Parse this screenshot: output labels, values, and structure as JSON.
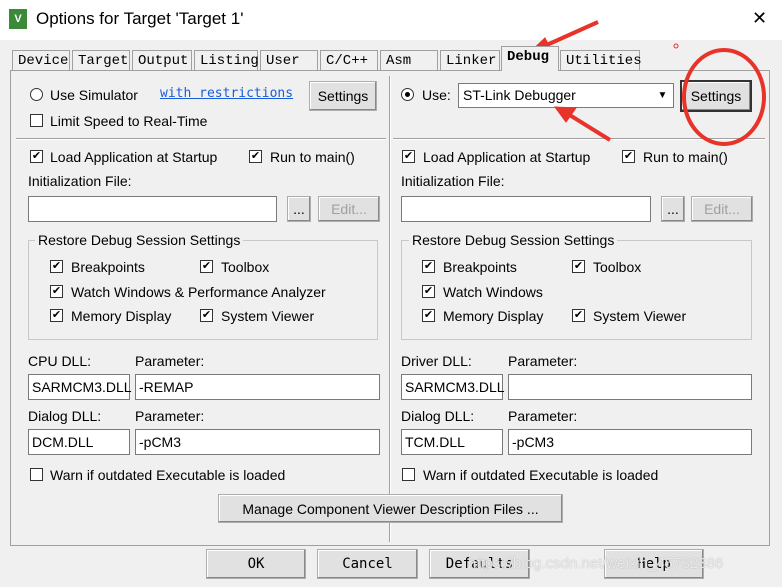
{
  "window": {
    "title": "Options for Target 'Target 1'",
    "close": "✕"
  },
  "tabs": [
    "Device",
    "Target",
    "Output",
    "Listing",
    "User",
    "C/C++",
    "Asm",
    "Linker",
    "Debug",
    "Utilities"
  ],
  "active_tab": "Debug",
  "left": {
    "use_simulator": "Use Simulator",
    "restrictions_link": "with restrictions",
    "settings": "Settings",
    "limit_speed": "Limit Speed to Real-Time",
    "load_app": "Load Application at Startup",
    "run_to_main": "Run to main()",
    "init_file_label": "Initialization File:",
    "init_file": "",
    "browse": "...",
    "edit": "Edit...",
    "restore_group": "Restore Debug Session Settings",
    "breakpoints": "Breakpoints",
    "toolbox": "Toolbox",
    "watch": "Watch Windows & Performance Analyzer",
    "memory": "Memory Display",
    "system_viewer": "System Viewer",
    "dll_label": "CPU DLL:",
    "param_label": "Parameter:",
    "dll": "SARMCM3.DLL",
    "dll_param": "-REMAP",
    "dialog_label": "Dialog DLL:",
    "dialog_param_label": "Parameter:",
    "dialog_dll": "DCM.DLL",
    "dialog_param": "-pCM3",
    "warn": "Warn if outdated Executable is loaded"
  },
  "right": {
    "use": "Use:",
    "debugger": "ST-Link Debugger",
    "settings": "Settings",
    "load_app": "Load Application at Startup",
    "run_to_main": "Run to main()",
    "init_file_label": "Initialization File:",
    "init_file": "",
    "browse": "...",
    "edit": "Edit...",
    "restore_group": "Restore Debug Session Settings",
    "breakpoints": "Breakpoints",
    "toolbox": "Toolbox",
    "watch": "Watch Windows",
    "memory": "Memory Display",
    "system_viewer": "System Viewer",
    "dll_label": "Driver DLL:",
    "param_label": "Parameter:",
    "dll": "SARMCM3.DLL",
    "dll_param": "",
    "dialog_label": "Dialog DLL:",
    "dialog_param_label": "Parameter:",
    "dialog_dll": "TCM.DLL",
    "dialog_param": "-pCM3",
    "warn": "Warn if outdated Executable is loaded"
  },
  "manage": "Manage Component Viewer Description Files ...",
  "buttons": {
    "ok": "OK",
    "cancel": "Cancel",
    "defaults": "Defaults",
    "help": "Help"
  },
  "watermark": "https://blog.csdn.net/weixin_45732386",
  "annotation_color": "#e8332a"
}
